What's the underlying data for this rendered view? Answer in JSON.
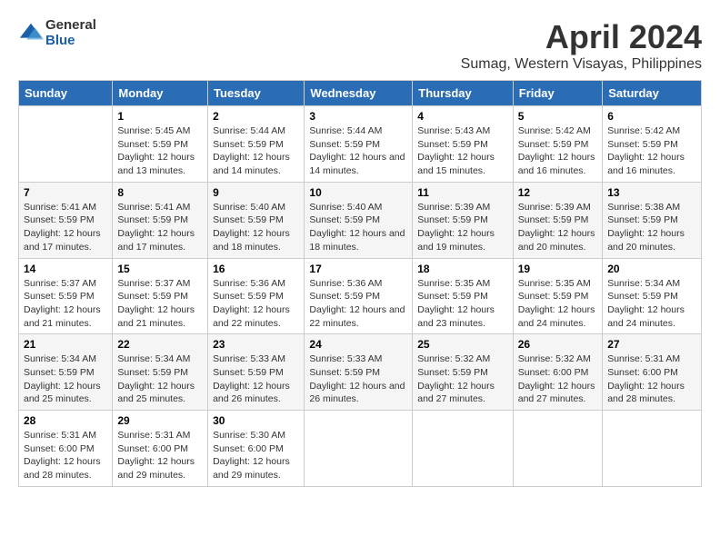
{
  "logo": {
    "general": "General",
    "blue": "Blue"
  },
  "title": "April 2024",
  "subtitle": "Sumag, Western Visayas, Philippines",
  "header_days": [
    "Sunday",
    "Monday",
    "Tuesday",
    "Wednesday",
    "Thursday",
    "Friday",
    "Saturday"
  ],
  "weeks": [
    [
      {
        "day": "",
        "sunrise": "",
        "sunset": "",
        "daylight": ""
      },
      {
        "day": "1",
        "sunrise": "5:45 AM",
        "sunset": "5:59 PM",
        "daylight": "Daylight: 12 hours and 13 minutes."
      },
      {
        "day": "2",
        "sunrise": "5:44 AM",
        "sunset": "5:59 PM",
        "daylight": "Daylight: 12 hours and 14 minutes."
      },
      {
        "day": "3",
        "sunrise": "5:44 AM",
        "sunset": "5:59 PM",
        "daylight": "Daylight: 12 hours and 14 minutes."
      },
      {
        "day": "4",
        "sunrise": "5:43 AM",
        "sunset": "5:59 PM",
        "daylight": "Daylight: 12 hours and 15 minutes."
      },
      {
        "day": "5",
        "sunrise": "5:42 AM",
        "sunset": "5:59 PM",
        "daylight": "Daylight: 12 hours and 16 minutes."
      },
      {
        "day": "6",
        "sunrise": "5:42 AM",
        "sunset": "5:59 PM",
        "daylight": "Daylight: 12 hours and 16 minutes."
      }
    ],
    [
      {
        "day": "7",
        "sunrise": "5:41 AM",
        "sunset": "5:59 PM",
        "daylight": "Daylight: 12 hours and 17 minutes."
      },
      {
        "day": "8",
        "sunrise": "5:41 AM",
        "sunset": "5:59 PM",
        "daylight": "Daylight: 12 hours and 17 minutes."
      },
      {
        "day": "9",
        "sunrise": "5:40 AM",
        "sunset": "5:59 PM",
        "daylight": "Daylight: 12 hours and 18 minutes."
      },
      {
        "day": "10",
        "sunrise": "5:40 AM",
        "sunset": "5:59 PM",
        "daylight": "Daylight: 12 hours and 18 minutes."
      },
      {
        "day": "11",
        "sunrise": "5:39 AM",
        "sunset": "5:59 PM",
        "daylight": "Daylight: 12 hours and 19 minutes."
      },
      {
        "day": "12",
        "sunrise": "5:39 AM",
        "sunset": "5:59 PM",
        "daylight": "Daylight: 12 hours and 20 minutes."
      },
      {
        "day": "13",
        "sunrise": "5:38 AM",
        "sunset": "5:59 PM",
        "daylight": "Daylight: 12 hours and 20 minutes."
      }
    ],
    [
      {
        "day": "14",
        "sunrise": "5:37 AM",
        "sunset": "5:59 PM",
        "daylight": "Daylight: 12 hours and 21 minutes."
      },
      {
        "day": "15",
        "sunrise": "5:37 AM",
        "sunset": "5:59 PM",
        "daylight": "Daylight: 12 hours and 21 minutes."
      },
      {
        "day": "16",
        "sunrise": "5:36 AM",
        "sunset": "5:59 PM",
        "daylight": "Daylight: 12 hours and 22 minutes."
      },
      {
        "day": "17",
        "sunrise": "5:36 AM",
        "sunset": "5:59 PM",
        "daylight": "Daylight: 12 hours and 22 minutes."
      },
      {
        "day": "18",
        "sunrise": "5:35 AM",
        "sunset": "5:59 PM",
        "daylight": "Daylight: 12 hours and 23 minutes."
      },
      {
        "day": "19",
        "sunrise": "5:35 AM",
        "sunset": "5:59 PM",
        "daylight": "Daylight: 12 hours and 24 minutes."
      },
      {
        "day": "20",
        "sunrise": "5:34 AM",
        "sunset": "5:59 PM",
        "daylight": "Daylight: 12 hours and 24 minutes."
      }
    ],
    [
      {
        "day": "21",
        "sunrise": "5:34 AM",
        "sunset": "5:59 PM",
        "daylight": "Daylight: 12 hours and 25 minutes."
      },
      {
        "day": "22",
        "sunrise": "5:34 AM",
        "sunset": "5:59 PM",
        "daylight": "Daylight: 12 hours and 25 minutes."
      },
      {
        "day": "23",
        "sunrise": "5:33 AM",
        "sunset": "5:59 PM",
        "daylight": "Daylight: 12 hours and 26 minutes."
      },
      {
        "day": "24",
        "sunrise": "5:33 AM",
        "sunset": "5:59 PM",
        "daylight": "Daylight: 12 hours and 26 minutes."
      },
      {
        "day": "25",
        "sunrise": "5:32 AM",
        "sunset": "5:59 PM",
        "daylight": "Daylight: 12 hours and 27 minutes."
      },
      {
        "day": "26",
        "sunrise": "5:32 AM",
        "sunset": "6:00 PM",
        "daylight": "Daylight: 12 hours and 27 minutes."
      },
      {
        "day": "27",
        "sunrise": "5:31 AM",
        "sunset": "6:00 PM",
        "daylight": "Daylight: 12 hours and 28 minutes."
      }
    ],
    [
      {
        "day": "28",
        "sunrise": "5:31 AM",
        "sunset": "6:00 PM",
        "daylight": "Daylight: 12 hours and 28 minutes."
      },
      {
        "day": "29",
        "sunrise": "5:31 AM",
        "sunset": "6:00 PM",
        "daylight": "Daylight: 12 hours and 29 minutes."
      },
      {
        "day": "30",
        "sunrise": "5:30 AM",
        "sunset": "6:00 PM",
        "daylight": "Daylight: 12 hours and 29 minutes."
      },
      {
        "day": "",
        "sunrise": "",
        "sunset": "",
        "daylight": ""
      },
      {
        "day": "",
        "sunrise": "",
        "sunset": "",
        "daylight": ""
      },
      {
        "day": "",
        "sunrise": "",
        "sunset": "",
        "daylight": ""
      },
      {
        "day": "",
        "sunrise": "",
        "sunset": "",
        "daylight": ""
      }
    ]
  ]
}
